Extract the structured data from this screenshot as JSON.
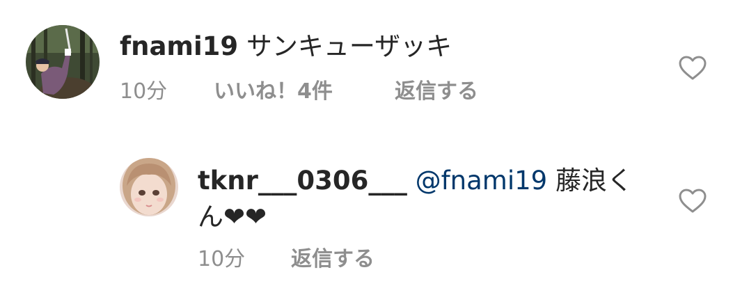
{
  "comments": [
    {
      "username": "fnami19",
      "text": "サンキューザッキ",
      "time": "10分",
      "likes": "いいね！4件",
      "reply": "返信する"
    },
    {
      "username": "tknr___0306___",
      "mention": "@fnami19",
      "text_line1": "藤浪く",
      "text_line2": "ん❤❤",
      "time": "10分",
      "reply": "返信する"
    }
  ],
  "icons": {
    "like": "heart-outline-icon"
  }
}
